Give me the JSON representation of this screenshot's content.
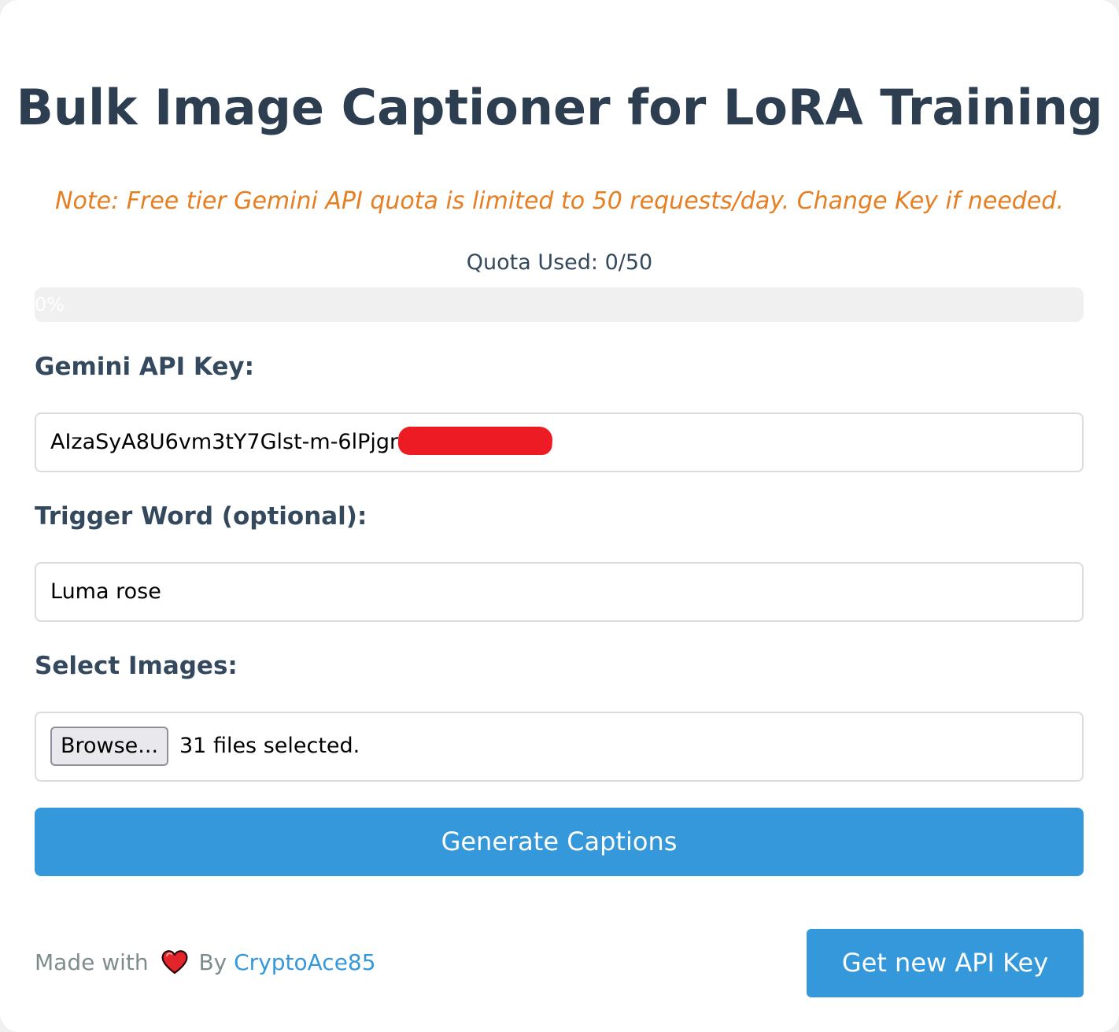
{
  "page": {
    "title": "Bulk Image Captioner for LoRA Training",
    "note": "Note: Free tier Gemini API quota is limited to 50 requests/day. Change Key if needed."
  },
  "quota": {
    "label": "Quota Used: 0/50",
    "used": 0,
    "limit": 50,
    "progress_label": "0%",
    "progress_fraction": 0
  },
  "form": {
    "api_key_label": "Gemini API Key:",
    "api_key_value": "AIzaSyA8U6vm3tY7Glst-m-6lPjgr",
    "trigger_label": "Trigger Word (optional):",
    "trigger_value": "Luma rose",
    "images_label": "Select Images:",
    "browse_label": "Browse...",
    "files_status": "31 files selected.",
    "generate_label": "Generate Captions"
  },
  "footer": {
    "made_with": "Made with",
    "by": "By",
    "author": "CryptoAce85",
    "heart_icon": "heart-icon",
    "api_button": "Get new API Key"
  },
  "colors": {
    "title": "#2c3e50",
    "note": "#e67e22",
    "accent": "#3498db",
    "redaction": "#ed1c24"
  }
}
